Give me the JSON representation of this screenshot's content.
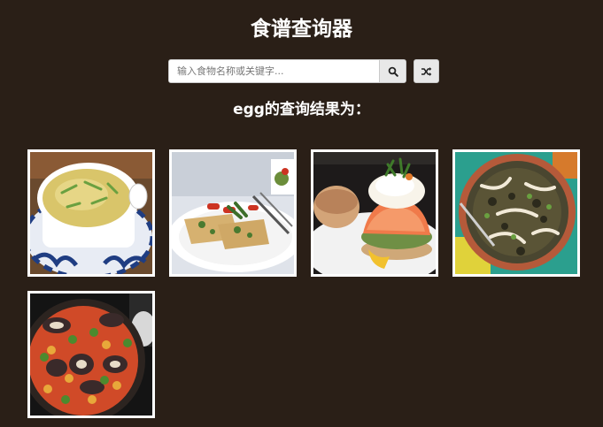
{
  "header": {
    "title": "食谱查询器"
  },
  "search": {
    "placeholder": "输入食物名称或关键字...",
    "value": "",
    "search_icon": "search-icon",
    "random_icon": "shuffle-icon"
  },
  "results": {
    "heading": "egg的查询结果为：",
    "items": [
      {
        "image": "egg-drop-soup-photo"
      },
      {
        "image": "omelette-wrap-photo"
      },
      {
        "image": "eggs-benedict-salmon-photo"
      },
      {
        "image": "lentil-dish-photo"
      },
      {
        "image": "paella-photo"
      }
    ]
  }
}
